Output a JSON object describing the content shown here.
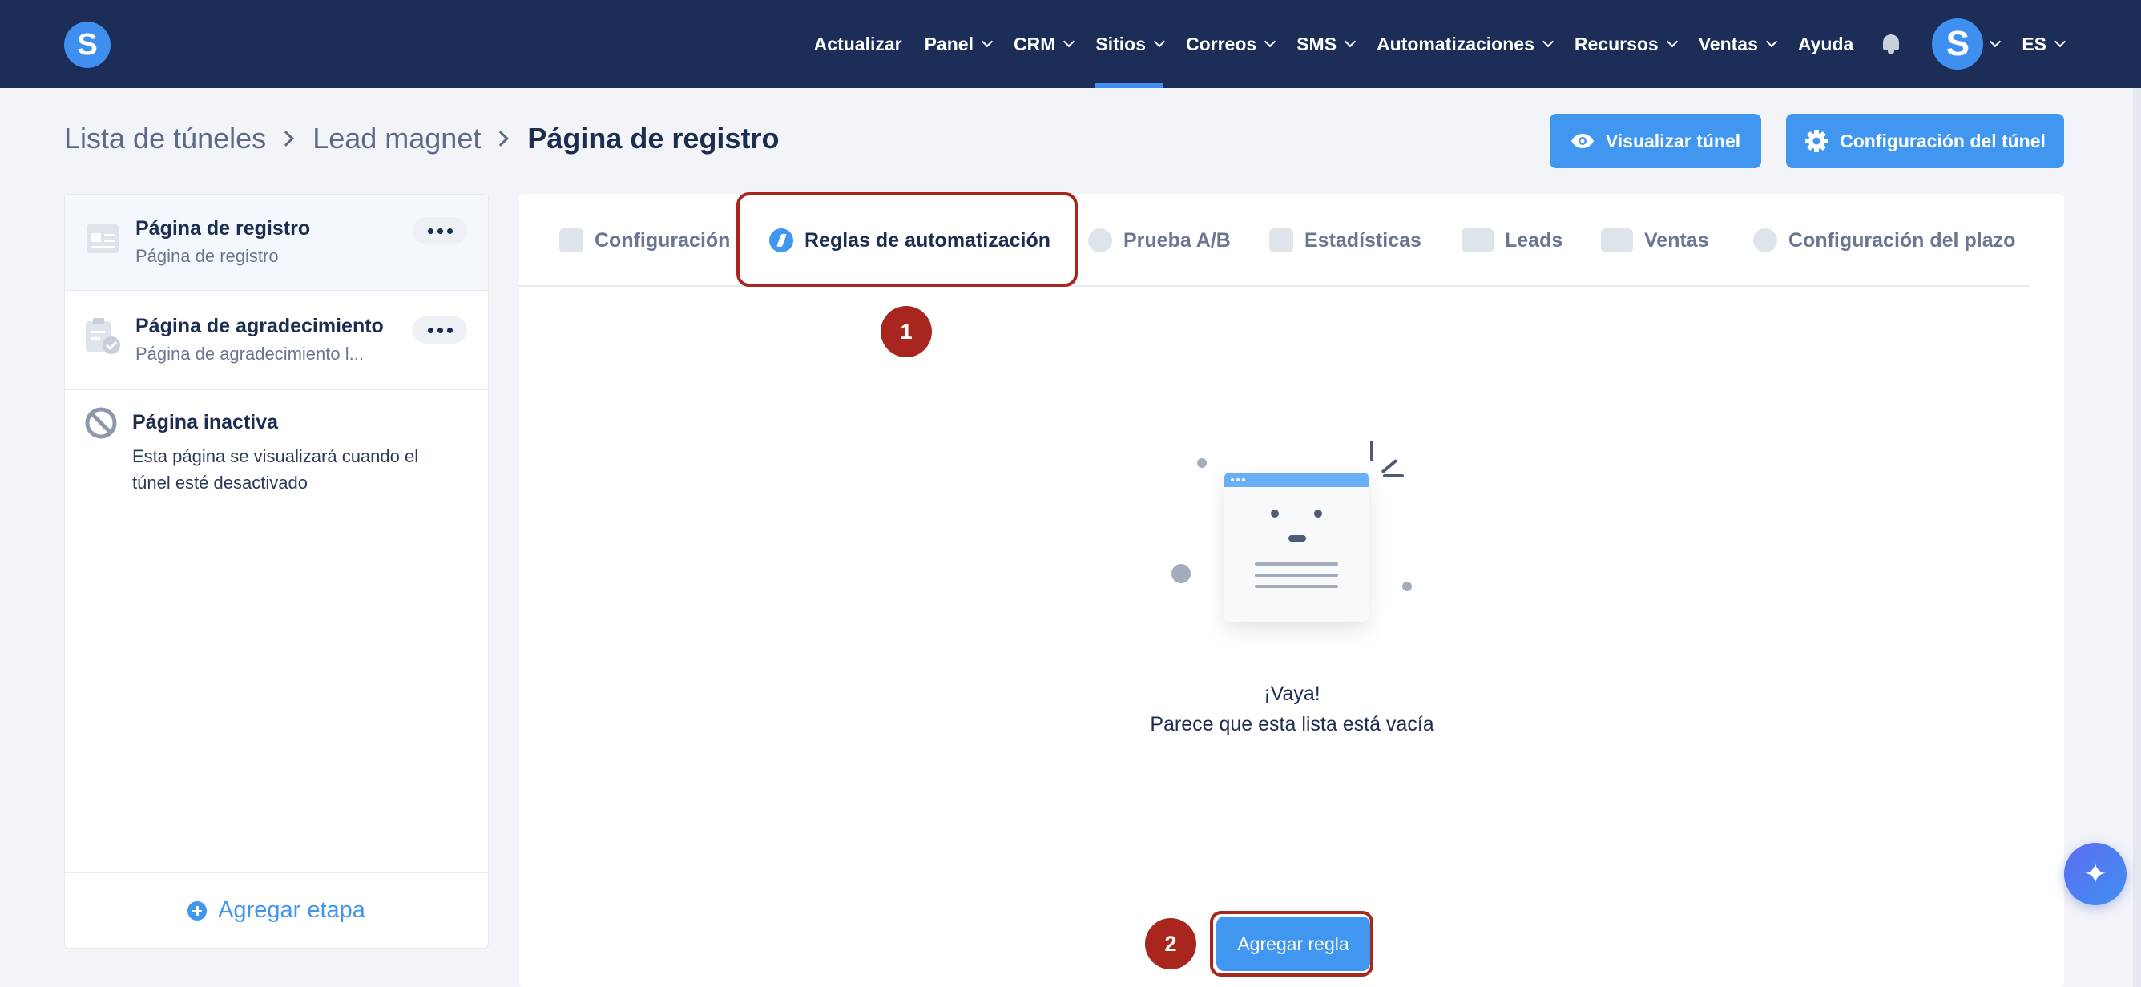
{
  "nav": {
    "items": [
      {
        "label": "Actualizar",
        "dropdown": false,
        "active": false
      },
      {
        "label": "Panel",
        "dropdown": true,
        "active": false
      },
      {
        "label": "CRM",
        "dropdown": true,
        "active": false
      },
      {
        "label": "Sitios",
        "dropdown": true,
        "active": true
      },
      {
        "label": "Correos",
        "dropdown": true,
        "active": false
      },
      {
        "label": "SMS",
        "dropdown": true,
        "active": false
      },
      {
        "label": "Automatizaciones",
        "dropdown": true,
        "active": false
      },
      {
        "label": "Recursos",
        "dropdown": true,
        "active": false
      },
      {
        "label": "Ventas",
        "dropdown": true,
        "active": false
      },
      {
        "label": "Ayuda",
        "dropdown": false,
        "active": false
      }
    ],
    "language": "ES",
    "logo_letter": "S",
    "avatar_letter": "S"
  },
  "breadcrumb": {
    "items": [
      "Lista de túneles",
      "Lead magnet"
    ],
    "current": "Página de registro"
  },
  "header": {
    "preview_label": "Visualizar túnel",
    "config_label": "Configuración del túnel"
  },
  "stages": [
    {
      "title": "Página de registro",
      "subtitle": "Página de registro",
      "icon": "page-layout-icon"
    },
    {
      "title": "Página de agradecimiento",
      "subtitle": "Página de agradecimiento l...",
      "icon": "clipboard-check-icon"
    },
    {
      "title": "Página inactiva",
      "description": "Esta página se visualizará cuando el túnel esté desactivado",
      "icon": "forbidden-icon"
    }
  ],
  "add_stage_label": "Agregar etapa",
  "tabs": [
    {
      "label": "Configuración",
      "icon": "sliders-icon"
    },
    {
      "label": "Reglas de automatización",
      "icon": "bolt-icon",
      "active": true
    },
    {
      "label": "Prueba A/B",
      "icon": "split-icon"
    },
    {
      "label": "Estadísticas",
      "icon": "bar-chart-icon"
    },
    {
      "label": "Leads",
      "icon": "users-icon"
    },
    {
      "label": "Ventas",
      "icon": "dollar-icon"
    },
    {
      "label": "Configuración del plazo",
      "icon": "clock-icon"
    }
  ],
  "empty_state": {
    "title": "¡Vaya!",
    "subtitle": "Parece que esta lista está vacía"
  },
  "add_rule_label": "Agregar regla",
  "annotations": {
    "step1": "1",
    "step2": "2"
  },
  "colors": {
    "navbar": "#1c2d58",
    "accent": "#4196f0",
    "highlight": "#a8261d"
  }
}
